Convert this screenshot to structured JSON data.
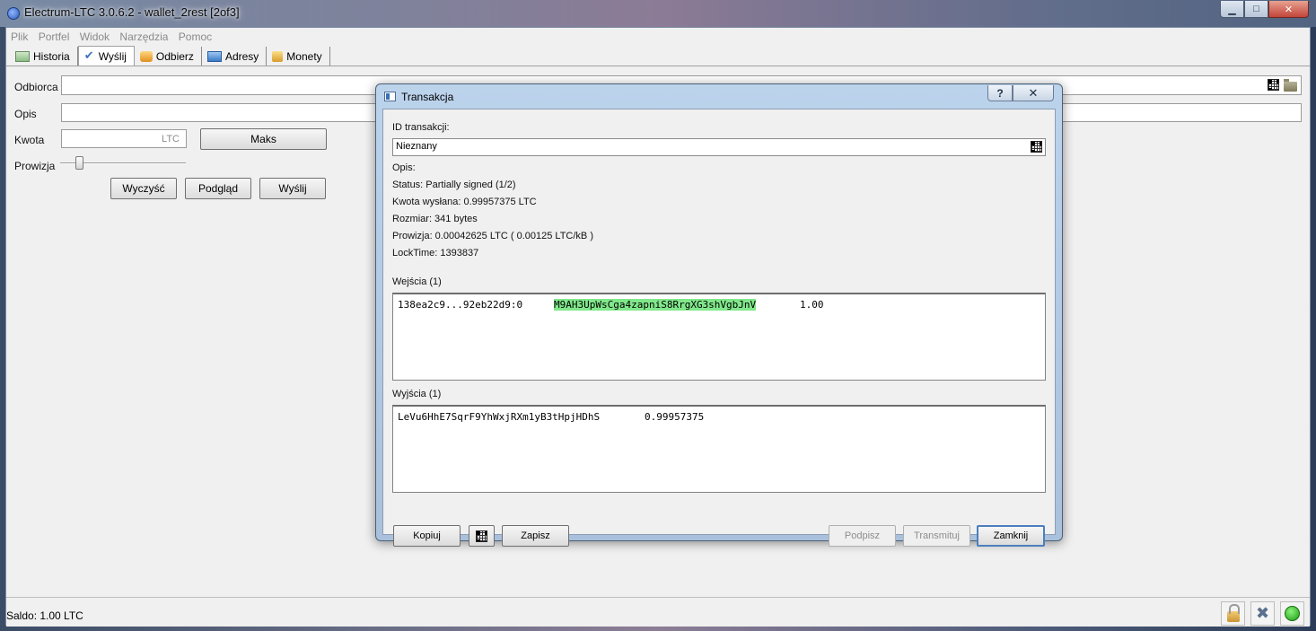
{
  "window": {
    "title": "Electrum-LTC 3.0.6.2  -  wallet_2rest  [2of3]",
    "caption": {
      "minimize": "▁",
      "maximize": "□",
      "close": "✕"
    }
  },
  "menu": [
    "Plik",
    "Portfel",
    "Widok",
    "Narzędzia",
    "Pomoc"
  ],
  "tabs": [
    {
      "label": "Historia",
      "icon": "history-icon"
    },
    {
      "label": "Wyślij",
      "icon": "send-icon",
      "active": true
    },
    {
      "label": "Odbierz",
      "icon": "receive-icon"
    },
    {
      "label": "Adresy",
      "icon": "addresses-icon"
    },
    {
      "label": "Monety",
      "icon": "coins-icon"
    }
  ],
  "send": {
    "recipient_label": "Odbiorca",
    "description_label": "Opis",
    "amount_label": "Kwota",
    "amount_unit": "LTC",
    "max_label": "Maks",
    "fee_label": "Prowizja",
    "clear_label": "Wyczyść",
    "preview_label": "Podgląd",
    "send_label": "Wyślij"
  },
  "status": {
    "balance": "Saldo: 1.00 LTC",
    "online_color": "#1c9a14"
  },
  "dialog": {
    "title": "Transakcja",
    "help": "?",
    "close": "✕",
    "txid_label": "ID transakcji:",
    "txid_value": "Nieznany",
    "description": "Opis:",
    "status": "Status: Partially signed (1/2)",
    "amount_sent": "Kwota wysłana: 0.99957375 LTC",
    "size": "Rozmiar: 341 bytes",
    "fee": "Prowizja: 0.00042625 LTC  ( 0.00125 LTC/kB )",
    "locktime": "LockTime: 1393837",
    "inputs_label": "Wejścia (1)",
    "inputs": [
      {
        "outpoint": "138ea2c9...92eb22d9:0",
        "address": "M9AH3UpWsCga4zapniS8RrgXG3shVgbJnV",
        "amount": "1.00",
        "highlight": "#80e88a"
      }
    ],
    "outputs_label": "Wyjścia (1)",
    "outputs": [
      {
        "address": "LeVu6HhE7SqrF9YhWxjRXm1yB3tHpjHDhS",
        "amount": "0.99957375"
      }
    ],
    "buttons": {
      "copy": "Kopiuj",
      "save": "Zapisz",
      "sign": "Podpisz",
      "broadcast": "Transmituj",
      "close": "Zamknij"
    }
  }
}
